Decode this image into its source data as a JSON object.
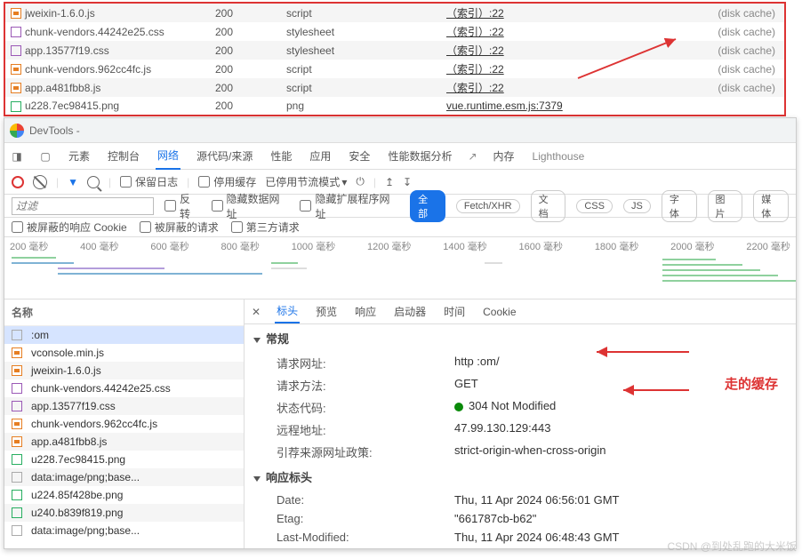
{
  "top_rows": [
    {
      "icon": "fi-orange",
      "name": "jweixin-1.6.0.js",
      "status": "200",
      "type": "script",
      "initiator": "（索引）:22",
      "size": "(disk cache)"
    },
    {
      "icon": "fi-purple",
      "name": "chunk-vendors.44242e25.css",
      "status": "200",
      "type": "stylesheet",
      "initiator": "（索引）:22",
      "size": "(disk cache)"
    },
    {
      "icon": "fi-purple",
      "name": "app.13577f19.css",
      "status": "200",
      "type": "stylesheet",
      "initiator": "（索引）:22",
      "size": "(disk cache)"
    },
    {
      "icon": "fi-orange",
      "name": "chunk-vendors.962cc4fc.js",
      "status": "200",
      "type": "script",
      "initiator": "（索引）:22",
      "size": "(disk cache)"
    },
    {
      "icon": "fi-orange",
      "name": "app.a481fbb8.js",
      "status": "200",
      "type": "script",
      "initiator": "（索引）:22",
      "size": "(disk cache)"
    },
    {
      "icon": "fi-green",
      "name": "u228.7ec98415.png",
      "status": "200",
      "type": "png",
      "initiator": "vue.runtime.esm.js:7379",
      "size": ""
    }
  ],
  "devtools_title": "DevTools -",
  "tabs": {
    "elements": "元素",
    "console": "控制台",
    "network": "网络",
    "sources": "源代码/来源",
    "performance": "性能",
    "application": "应用",
    "security": "安全",
    "perfinsights": "性能数据分析",
    "memory": "内存",
    "lighthouse": "Lighthouse"
  },
  "toolbar": {
    "preserve": "保留日志",
    "disable_cache": "停用缓存",
    "throttle": "已停用节流模式"
  },
  "filter": {
    "placeholder": "过滤",
    "invert": "反转",
    "hide_data": "隐藏数据网址",
    "hide_ext": "隐藏扩展程序网址",
    "all": "全部",
    "fetch": "Fetch/XHR",
    "doc": "文档",
    "css": "CSS",
    "js": "JS",
    "font": "字体",
    "img": "图片",
    "media": "媒体"
  },
  "cookies": {
    "blocked_resp": "被屏蔽的响应 Cookie",
    "blocked_req": "被屏蔽的请求",
    "third": "第三方请求"
  },
  "ticks": [
    "200 毫秒",
    "400 毫秒",
    "600 毫秒",
    "800 毫秒",
    "1000 毫秒",
    "1200 毫秒",
    "1400 毫秒",
    "1600 毫秒",
    "1800 毫秒",
    "2000 毫秒",
    "2200 毫秒"
  ],
  "name_header": "名称",
  "requests": [
    {
      "icon": "fi-gray",
      "name": ":om",
      "sel": true
    },
    {
      "icon": "fi-orange",
      "name": "vconsole.min.js"
    },
    {
      "icon": "fi-orange",
      "name": "jweixin-1.6.0.js"
    },
    {
      "icon": "fi-purple",
      "name": "chunk-vendors.44242e25.css"
    },
    {
      "icon": "fi-purple",
      "name": "app.13577f19.css"
    },
    {
      "icon": "fi-orange",
      "name": "chunk-vendors.962cc4fc.js"
    },
    {
      "icon": "fi-orange",
      "name": "app.a481fbb8.js"
    },
    {
      "icon": "fi-green",
      "name": "u228.7ec98415.png"
    },
    {
      "icon": "fi-gray",
      "name": "data:image/png;base..."
    },
    {
      "icon": "fi-green",
      "name": "u224.85f428be.png"
    },
    {
      "icon": "fi-green",
      "name": "u240.b839f819.png"
    },
    {
      "icon": "fi-gray",
      "name": "data:image/png;base..."
    }
  ],
  "detail_tabs": {
    "headers": "标头",
    "preview": "预览",
    "response": "响应",
    "initiator": "启动器",
    "timing": "时间",
    "cookies": "Cookie"
  },
  "sections": {
    "general": "常规",
    "response_headers": "响应标头"
  },
  "general": {
    "url_k": "请求网址:",
    "url_v": "http                                   :om/",
    "method_k": "请求方法:",
    "method_v": "GET",
    "status_k": "状态代码:",
    "status_v": "304 Not Modified",
    "remote_k": "远程地址:",
    "remote_v": "47.99.130.129:443",
    "refpol_k": "引荐来源网址政策:",
    "refpol_v": "strict-origin-when-cross-origin"
  },
  "resp_headers": {
    "date_k": "Date:",
    "date_v": "Thu, 11 Apr 2024 06:56:01 GMT",
    "etag_k": "Etag:",
    "etag_v": "\"661787cb-b62\"",
    "lm_k": "Last-Modified:",
    "lm_v": "Thu, 11 Apr 2024 06:48:43 GMT"
  },
  "annotation": "走的缓存",
  "watermark": "CSDN @到处乱跑的大米饭"
}
